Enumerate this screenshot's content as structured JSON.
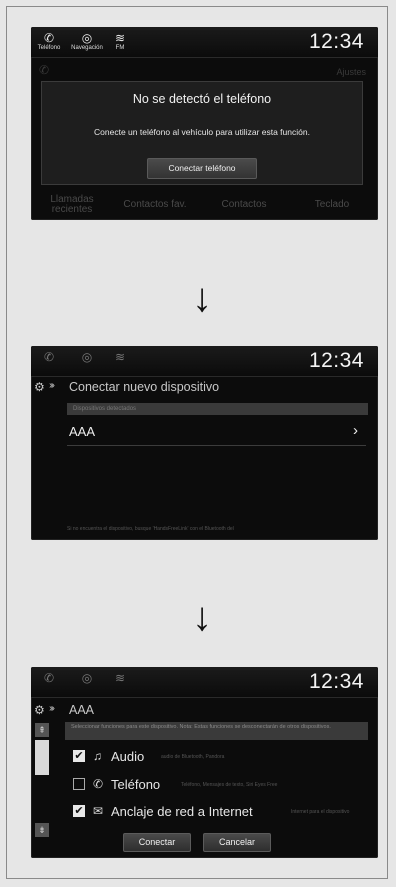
{
  "status_bar": {
    "phone_label": "Teléfono",
    "nav_label": "Navegación",
    "fm_label": "FM",
    "clock": "12:34"
  },
  "screen1": {
    "settings_ghost": "Ajustes",
    "dialog": {
      "title": "No se detectó el teléfono",
      "message": "Conecte un teléfono al vehículo para utilizar esta función.",
      "button": "Conectar teléfono"
    },
    "tabs": [
      "Llamadas recientes",
      "Contactos fav.",
      "Contactos",
      "Teclado"
    ]
  },
  "screen2": {
    "title": "Conectar nuevo dispositivo",
    "subheader": "Dispositivos detectados",
    "device_name": "AAA",
    "footnote": "Si no encuentra el dispositivo, busque 'HandsFreeLink' con el Bluetooth del"
  },
  "screen3": {
    "title": "AAA",
    "info": "Seleccionar funciones para este dispositivo. Nota: Estas funciones se desconectarán de otros dispositivos.",
    "options": [
      {
        "label": "Audio",
        "checked": true,
        "icon": "music-note-icon",
        "desc": "audio de Bluetooth, Pandora"
      },
      {
        "label": "Teléfono",
        "checked": false,
        "icon": "phone-icon",
        "desc": "Teléfono, Mensajes de texto, Siri Eyes Free"
      },
      {
        "label": "Anclaje de red a Internet",
        "checked": true,
        "icon": "mail-icon",
        "desc": "Internet para el dispositivo"
      }
    ],
    "connect_button": "Conectar",
    "cancel_button": "Cancelar"
  },
  "arrows": {
    "symbol": "↓"
  }
}
